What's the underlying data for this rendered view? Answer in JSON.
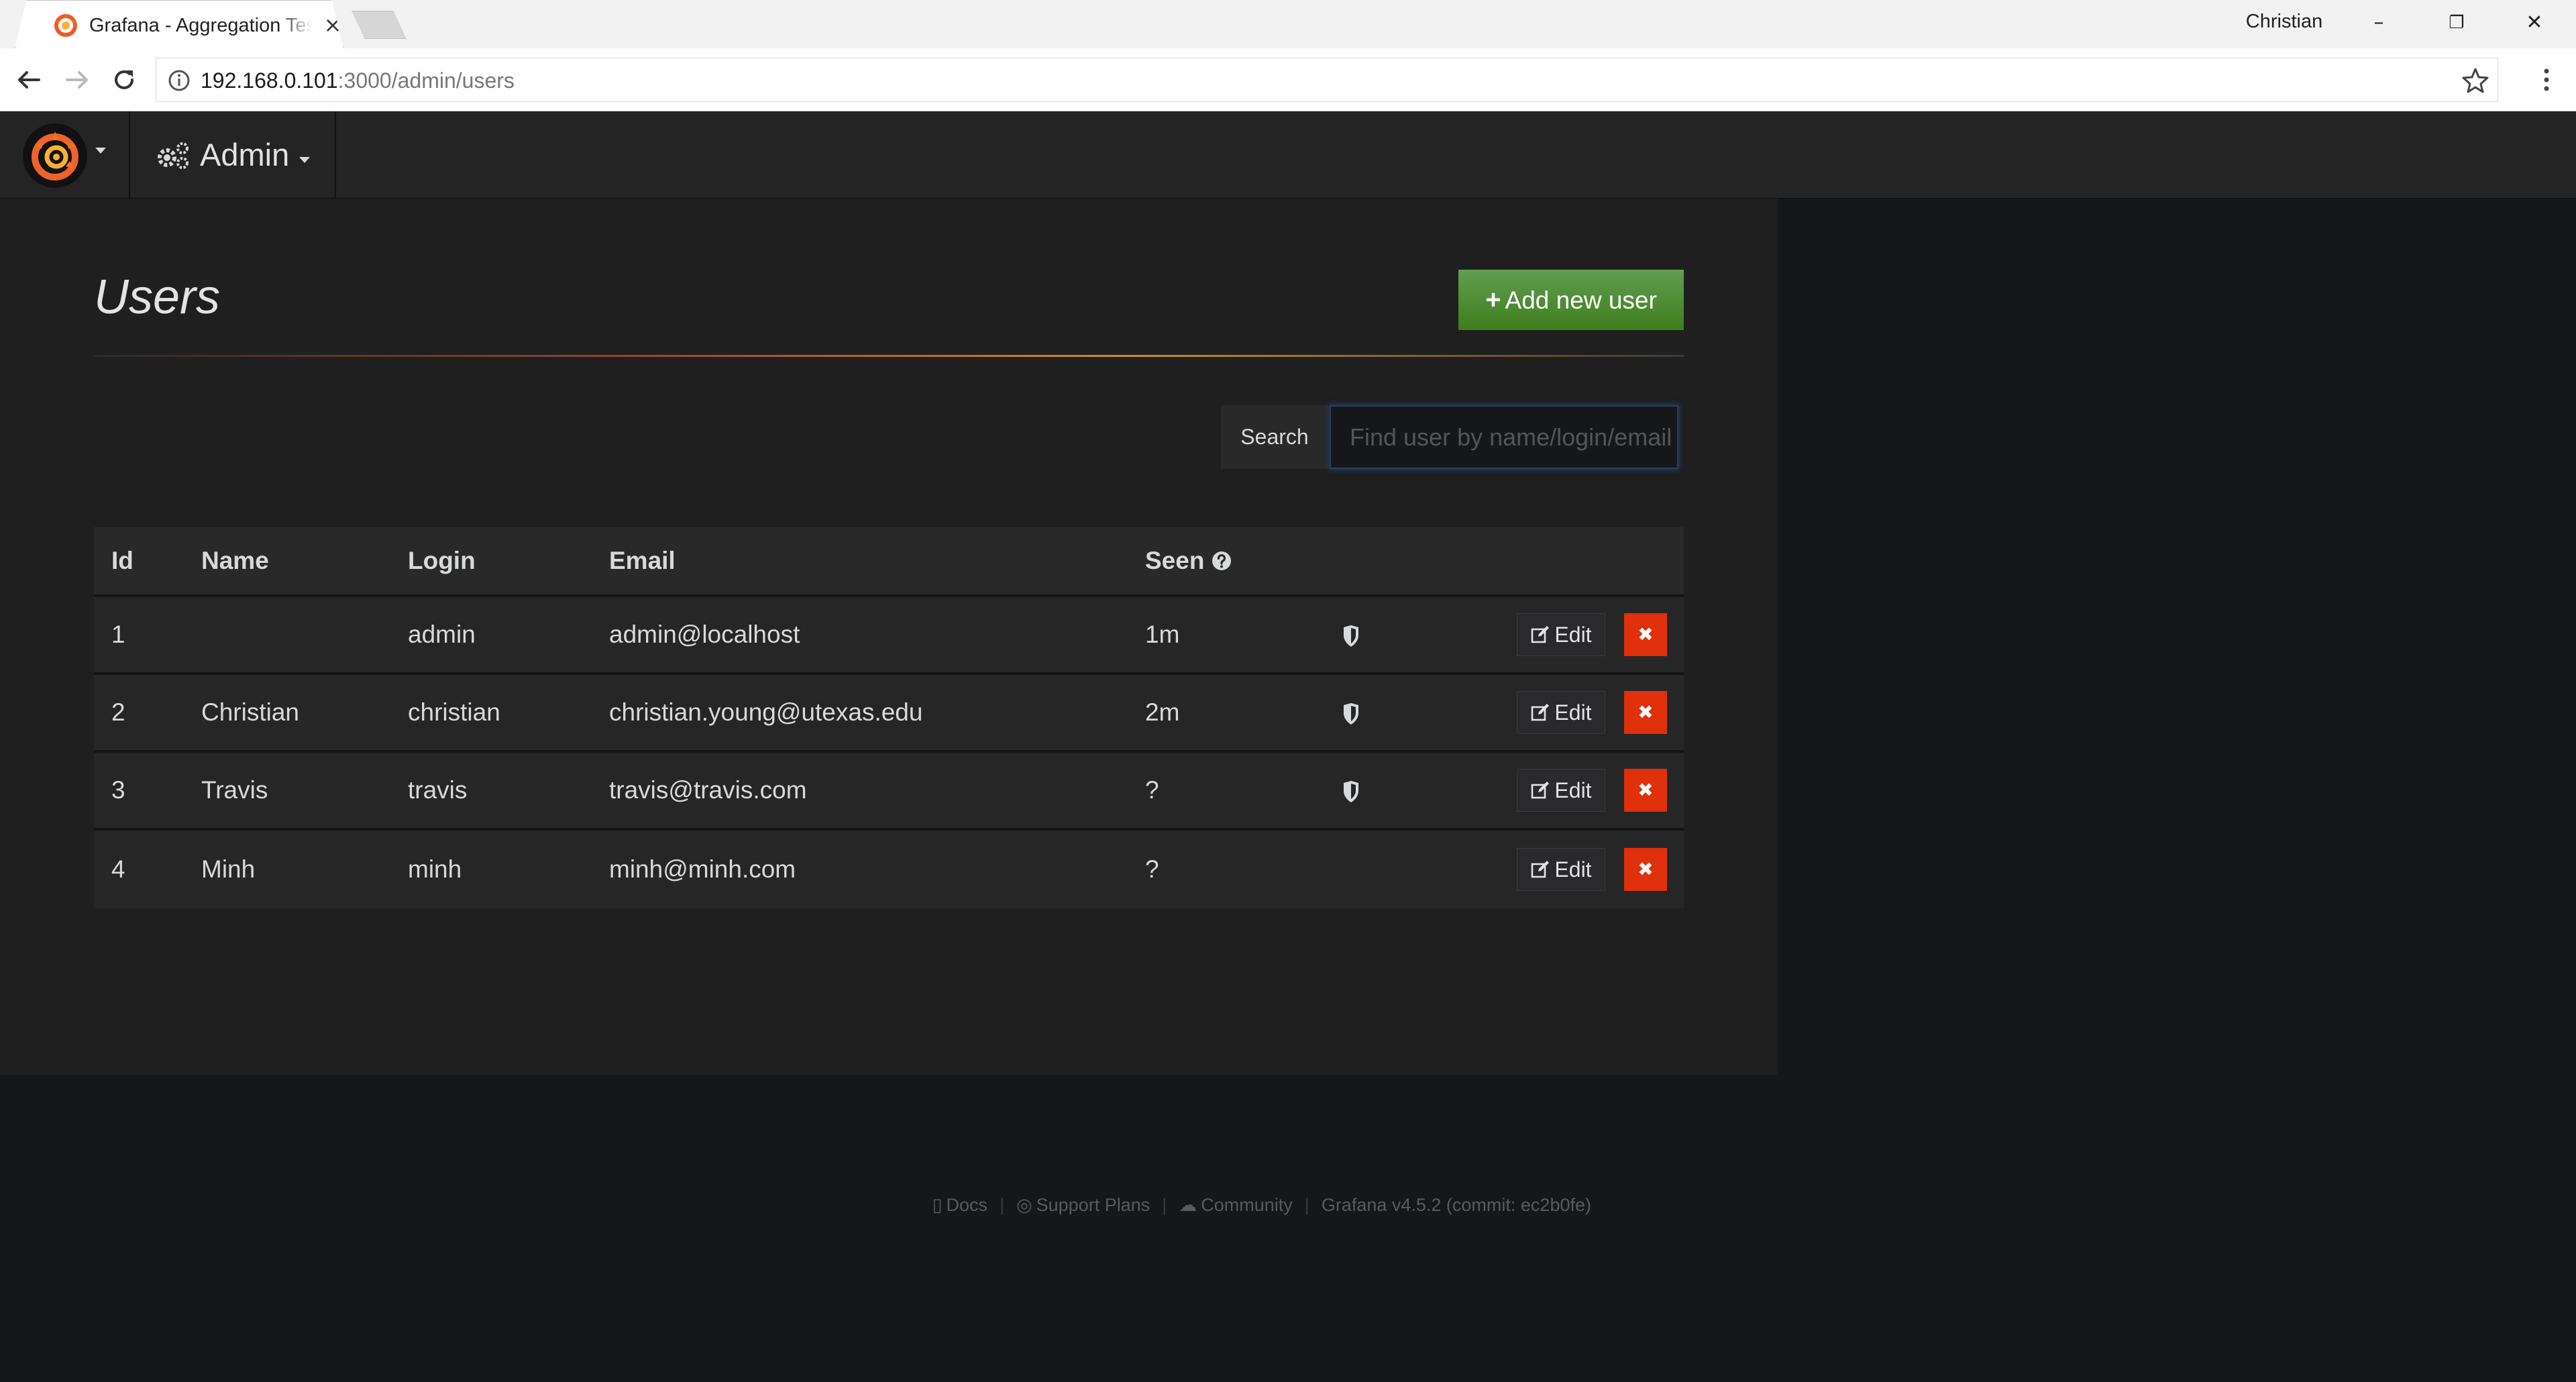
{
  "browser": {
    "tab_title": "Grafana - Aggregation Testing",
    "tab_close": "×",
    "profile_name": "Christian",
    "window_controls": {
      "minimize": "–",
      "restore": "❐",
      "close": "✕"
    },
    "url_host": "192.168.0.101",
    "url_path": ":3000/admin/users"
  },
  "grafana": {
    "section_label": "Admin",
    "icons": {
      "logo": "grafana-logo-icon",
      "section": "cogs-icon"
    }
  },
  "page": {
    "title": "Users",
    "add_button_icon": "+",
    "add_button_label": "Add new user",
    "search_label": "Search",
    "search_placeholder": "Find user by name/login/email"
  },
  "table": {
    "headers": {
      "id": "Id",
      "name": "Name",
      "login": "Login",
      "email": "Email",
      "seen": "Seen"
    },
    "rows": [
      {
        "id": "1",
        "name": "",
        "login": "admin",
        "email": "admin@localhost",
        "seen": "1m",
        "is_admin": true
      },
      {
        "id": "2",
        "name": "Christian",
        "login": "christian",
        "email": "christian.young@utexas.edu",
        "seen": "2m",
        "is_admin": true
      },
      {
        "id": "3",
        "name": "Travis",
        "login": "travis",
        "email": "travis@travis.com",
        "seen": "?",
        "is_admin": true
      },
      {
        "id": "4",
        "name": "Minh",
        "login": "minh",
        "email": "minh@minh.com",
        "seen": "?",
        "is_admin": false
      }
    ],
    "edit_label": "Edit",
    "delete_label": "✖"
  },
  "footer": {
    "docs": "Docs",
    "support": "Support Plans",
    "community": "Community",
    "version": "Grafana v4.5.2 (commit: ec2b0fe)",
    "separator": "|"
  },
  "colors": {
    "add_button": "#4a8a25",
    "delete_button": "#e02f0b",
    "page_bg": "#161719",
    "panel_bg": "#1f1f20"
  }
}
